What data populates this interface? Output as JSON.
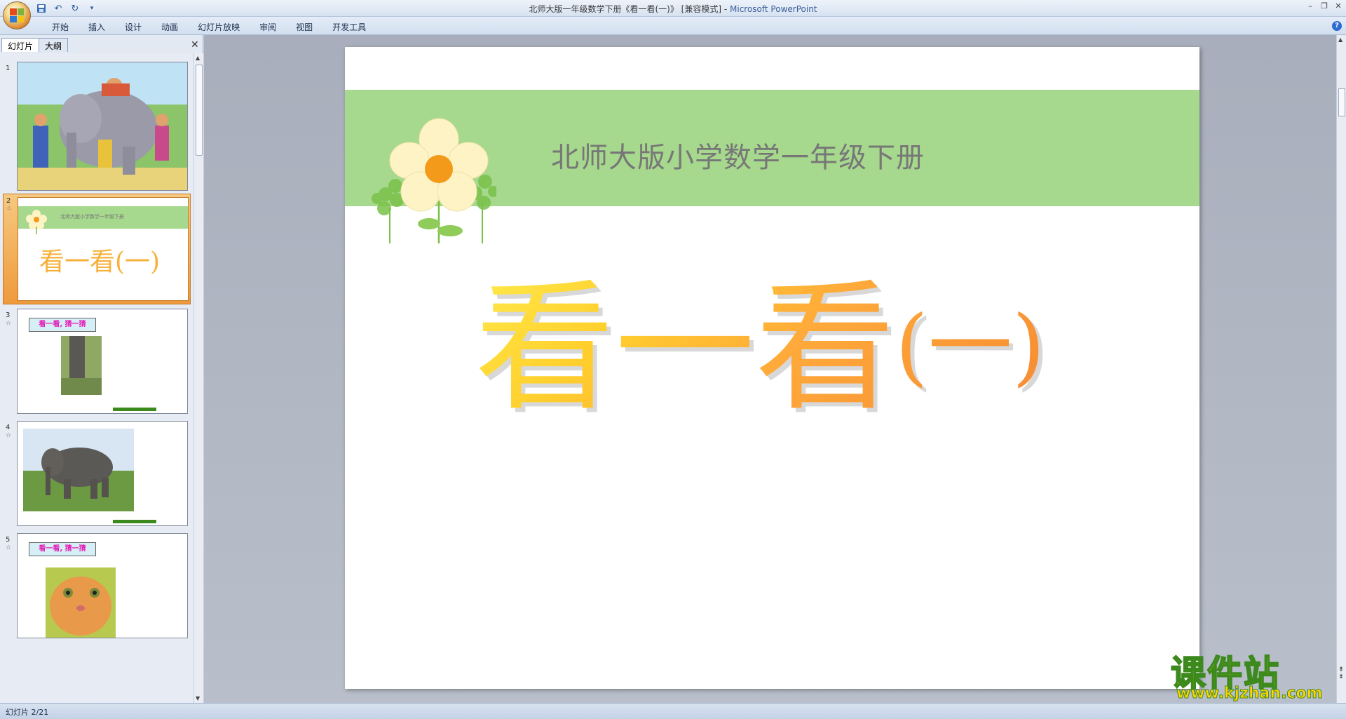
{
  "window": {
    "title_doc": "北师大版一年级数学下册《看一看(一)》 [兼容模式] - ",
    "title_app": "Microsoft PowerPoint"
  },
  "ribbon": {
    "tabs": [
      "开始",
      "插入",
      "设计",
      "动画",
      "幻灯片放映",
      "审阅",
      "视图",
      "开发工具"
    ]
  },
  "left_panel": {
    "tabs": [
      "幻灯片",
      "大纲"
    ],
    "close": "✕"
  },
  "thumbnails": [
    {
      "num": "1"
    },
    {
      "num": "2",
      "header": "北师大版小学数学一年级下册",
      "title": "看一看(一)"
    },
    {
      "num": "3",
      "label": "看一看, 猜一猜"
    },
    {
      "num": "4"
    },
    {
      "num": "5",
      "label": "看一看, 猜一猜"
    }
  ],
  "slide": {
    "subtitle": "北师大版小学数学一年级下册",
    "title_main": "看一看",
    "title_paren": "(一)"
  },
  "status": {
    "slide_info": "幻灯片 2/21"
  },
  "watermark": {
    "text": "课件站",
    "url": "www.kjzhan.com"
  },
  "colors": {
    "green_band": "#a6d88d",
    "title_gradient_start": "#ffe94a",
    "title_gradient_end": "#f58a33"
  }
}
